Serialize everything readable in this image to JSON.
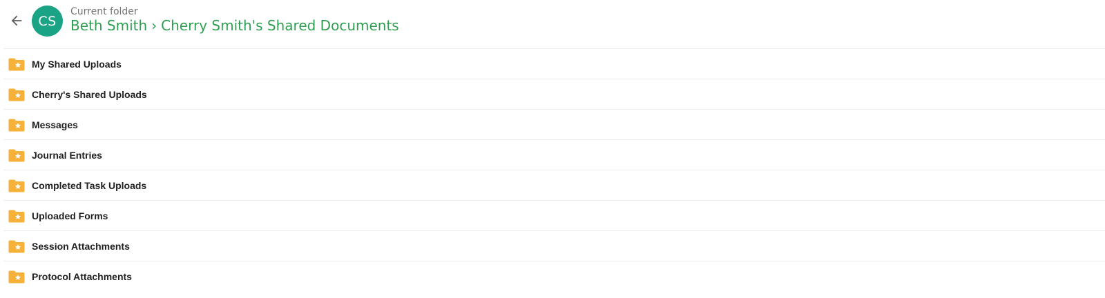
{
  "header": {
    "avatar_initials": "CS",
    "avatar_color": "#1aa385",
    "caption": "Current folder",
    "breadcrumb": [
      "Beth Smith",
      "Cherry Smith's Shared Documents"
    ],
    "breadcrumb_separator": "›",
    "breadcrumb_color": "#2e9e50"
  },
  "folder_icon": "starred-folder-icon",
  "folder_color": "#f6b13a",
  "folders": [
    {
      "label": "My Shared Uploads"
    },
    {
      "label": "Cherry's Shared Uploads"
    },
    {
      "label": "Messages"
    },
    {
      "label": "Journal Entries"
    },
    {
      "label": "Completed Task Uploads"
    },
    {
      "label": "Uploaded Forms"
    },
    {
      "label": "Session Attachments"
    },
    {
      "label": "Protocol Attachments"
    }
  ]
}
